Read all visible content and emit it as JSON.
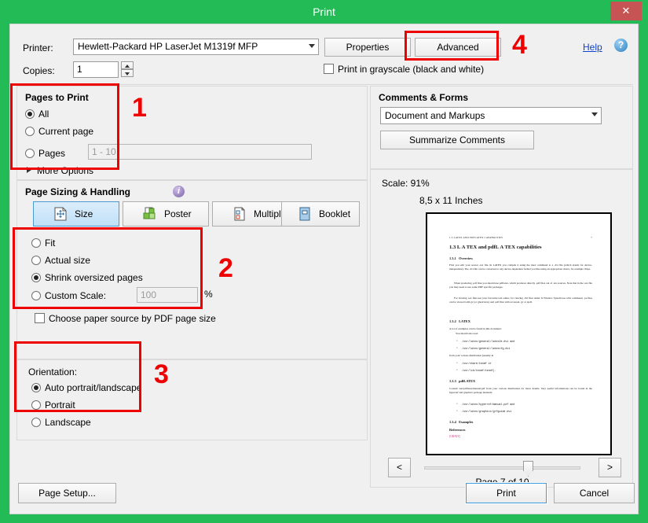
{
  "window": {
    "title": "Print",
    "close_label": "✕",
    "accent_green": "#22bb55",
    "close_red": "#c75454",
    "annotation_red": "#ee0000"
  },
  "top": {
    "printer_label": "Printer:",
    "printer_value": "Hewlett-Packard HP LaserJet M1319f MFP",
    "properties_label": "Properties",
    "advanced_label": "Advanced",
    "help_label": "Help",
    "help_icon_glyph": "?",
    "copies_label": "Copies:",
    "copies_value": "1",
    "grayscale_label": "Print in grayscale (black and white)",
    "grayscale_checked": false
  },
  "pages_to_print": {
    "title": "Pages to Print",
    "options": [
      {
        "label": "All",
        "selected": true
      },
      {
        "label": "Current page",
        "selected": false
      },
      {
        "label": "Pages",
        "selected": false
      }
    ],
    "range_placeholder": "1 - 10",
    "more_options_label": "More Options"
  },
  "page_sizing": {
    "title": "Page Sizing & Handling",
    "info_glyph": "i",
    "buttons": [
      {
        "label": "Size",
        "icon": "page-resize-icon",
        "active": true
      },
      {
        "label": "Poster",
        "icon": "poster-tiles-icon",
        "active": false
      },
      {
        "label": "Multiple",
        "icon": "multiple-pages-icon",
        "active": false
      },
      {
        "label": "Booklet",
        "icon": "booklet-icon",
        "active": false
      }
    ],
    "scale_options": [
      {
        "label": "Fit",
        "selected": false
      },
      {
        "label": "Actual size",
        "selected": false
      },
      {
        "label": "Shrink oversized pages",
        "selected": true
      },
      {
        "label": "Custom Scale:",
        "selected": false
      }
    ],
    "custom_scale_value": "100",
    "percent_sign": "%",
    "paper_source_label": "Choose paper source by PDF page size",
    "paper_source_checked": false
  },
  "orientation": {
    "title": "Orientation:",
    "options": [
      {
        "label": "Auto portrait/landscape",
        "selected": true
      },
      {
        "label": "Portrait",
        "selected": false
      },
      {
        "label": "Landscape",
        "selected": false
      }
    ]
  },
  "comments_forms": {
    "title": "Comments & Forms",
    "select_value": "Document and Markups",
    "summarize_label": "Summarize Comments"
  },
  "preview": {
    "scale_text": "Scale:  91%",
    "paper_size_text": "8,5 x 11 Inches",
    "prev_label": "<",
    "next_label": ">",
    "page_indicator": "Page 7 of 10",
    "slider_value": 7,
    "slider_min": 1,
    "slider_max": 10,
    "document": {
      "running_head_left": "1.3  LATEX AND PDFLATEX CAPABILITIES",
      "running_head_right": "7",
      "heading": "1.3    L A TEX and pdfL A TEX capabilities",
      "sub1_number": "1.3.1",
      "sub1_title": "Overview",
      "para1": "First you edit your source .tex file. In LATEX you compile it using the latex command to a .dvi file (which stands for device-independent). The .dvi file can be converted to any device-dependent format you like using an appropriate driver, for example dvips.",
      "para2": "When producing .pdf files you should use pdflatex, which produces directly .pdf files out of .tex sources. Note that in the .tex file you may need to use some PDF specific packages.",
      "para3": "For viewing .tex files use your favourite text editor, for viewing .dvi files under X Window System use xdvi command, .ps files can be viewed with gv (or ghostview) and .pdf files with acroread, gv or xpdf.",
      "sub2_number": "1.3.2",
      "sub2_title": "LATEX",
      "sub2_intro": "A lot of examples can be found in this document.",
      "sub2_intro2": "You should also read",
      "sub2_items": [
        "/usr/latex/general/latex2e.dvi and",
        "/usr/latex/general/latexcfg.dvi"
      ],
      "sub2_mid": "from your various distribution (usually in",
      "sub2_items2": [
        "/usr/share/texmf or",
        "/usr/lib/texmf/texmf)."
      ],
      "sub3_number": "1.3.3",
      "sub3_title": "pdfLATEX",
      "sub3_para": "Consult /usr/pdflatex/manual.pdf from your various distribution for more details. Very useful informations can be found in the hyperref and graphicx package manuals:",
      "sub3_items": [
        "/usr/latex/hyperref/manual.pdf and",
        "/usr/latex/graphicx/grfguide.dvi"
      ],
      "sub4_number": "1.3.4",
      "sub4_title": "Examples",
      "references_label": "References",
      "pink_text": "[GRATZ]"
    }
  },
  "bottom": {
    "page_setup_label": "Page Setup...",
    "print_label": "Print",
    "cancel_label": "Cancel"
  },
  "annotations": [
    {
      "number": "1",
      "target": "pages-to-print-group"
    },
    {
      "number": "2",
      "target": "scale-options-group"
    },
    {
      "number": "3",
      "target": "orientation-group"
    },
    {
      "number": "4",
      "target": "advanced-button"
    }
  ]
}
